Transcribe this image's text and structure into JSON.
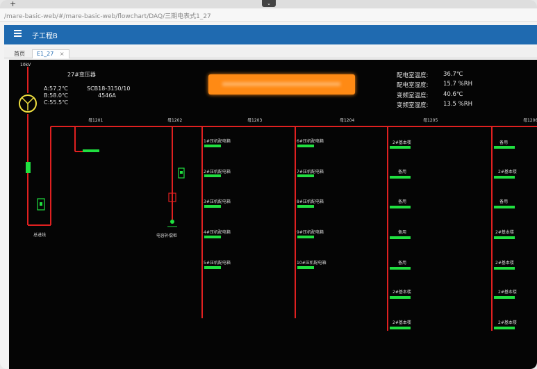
{
  "browser": {
    "new_tab": "+",
    "download": "⌄",
    "url": "/mare-basic-web/#/mare-basic-web/flowchart/DAQ/三期电表式1_27"
  },
  "app": {
    "title": "子工程B"
  },
  "tabs": [
    {
      "label": "首页"
    },
    {
      "label": "E1_27",
      "close": "×"
    }
  ],
  "diagram": {
    "source": "10kV",
    "transformer": {
      "title": "27#变压器",
      "model": "SCB18-3150/10",
      "current": "4546A",
      "temps": [
        "A:57.2℃",
        "B:58.0℃",
        "C:55.5℃"
      ]
    },
    "room_status": [
      {
        "label": "配电室温度:",
        "value": "36.7℃"
      },
      {
        "label": "配电室湿度:",
        "value": "15.7 %RH"
      },
      {
        "label": "变频室温度:",
        "value": "40.6℃"
      },
      {
        "label": "变频室湿度:",
        "value": "13.5 %RH"
      }
    ],
    "incoming_label": "总进线",
    "cap_label": "电容补偿柜",
    "bus_labels": [
      "母1201",
      "母1202",
      "母1203",
      "母1204",
      "母1205",
      "母1206"
    ],
    "feeder_col1": [
      "1#压机配电箱",
      "2#压机配电箱",
      "3#压机配电箱",
      "4#压机配电箱",
      "5#压机配电箱"
    ],
    "feeder_col2": [
      "6#压机配电箱",
      "7#压机配电箱",
      "8#压机配电箱",
      "9#压机配电箱",
      "10#压机配电箱"
    ],
    "feeder_col3": [
      "2#基本楼",
      "备用",
      "备用",
      "备用",
      "备用",
      "2#基本楼",
      "2#基本楼"
    ],
    "feeder_col4": [
      "备用",
      "2#基本楼",
      "备用",
      "2#基本楼",
      "2#基本楼",
      "2#基本楼",
      "2#基本楼"
    ]
  }
}
